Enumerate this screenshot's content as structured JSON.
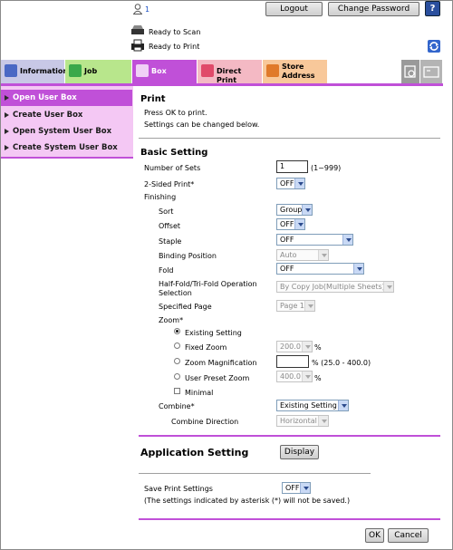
{
  "header": {
    "user_count": "1",
    "logout_label": "Logout",
    "change_password_label": "Change Password",
    "help_label": "?",
    "status_scan": "Ready to Scan",
    "status_print": "Ready to Print"
  },
  "tabs": [
    {
      "label": "Information",
      "color": "#c8c8e6",
      "icon": "information-icon"
    },
    {
      "label": "Job",
      "color": "#b8e68c",
      "icon": "job-icon"
    },
    {
      "label": "Box",
      "color": "#c050d8",
      "icon": "box-icon"
    },
    {
      "label": "Direct Print",
      "color": "#f4b9c4",
      "icon": "direct-print-icon"
    },
    {
      "label": "Store Address",
      "color": "#f8c89a",
      "icon": "store-address-icon"
    }
  ],
  "sidebar": {
    "items": [
      {
        "label": "Open User Box"
      },
      {
        "label": "Create User Box"
      },
      {
        "label": "Open System User Box"
      },
      {
        "label": "Create System User Box"
      }
    ]
  },
  "print": {
    "title": "Print",
    "line1": "Press OK to print.",
    "line2": "Settings can be changed below."
  },
  "basic": {
    "title": "Basic Setting",
    "sets_label": "Number of Sets",
    "sets_value": "1",
    "sets_range": "(1~999)",
    "sided_label": "2-Sided Print*",
    "sided_value": "OFF",
    "finishing_label": "Finishing",
    "sort_label": "Sort",
    "sort_value": "Group",
    "offset_label": "Offset",
    "offset_value": "OFF",
    "staple_label": "Staple",
    "staple_value": "OFF",
    "binding_label": "Binding Position",
    "binding_value": "Auto",
    "fold_label": "Fold",
    "fold_value": "OFF",
    "halffold_label1": "Half-Fold/Tri-Fold Operation",
    "halffold_label2": "Selection",
    "halffold_value": "By Copy Job(Multiple Sheets)",
    "specified_label": "Specified Page",
    "specified_value": "Page 1",
    "zoom_label": "Zoom*",
    "zoom_existing": "Existing Setting",
    "zoom_fixed": "Fixed Zoom",
    "zoom_fixed_value": "200.0",
    "zoom_mag": "Zoom Magnification",
    "zoom_mag_value": "",
    "zoom_mag_range": "% (25.0 - 400.0)",
    "zoom_preset": "User Preset Zoom",
    "zoom_preset_value": "400.0",
    "zoom_minimal": "Minimal",
    "percent": "%",
    "combine_label": "Combine*",
    "combine_value": "Existing Setting",
    "combine_dir_label": "Combine Direction",
    "combine_dir_value": "Horizontal"
  },
  "application": {
    "title": "Application Setting",
    "display_label": "Display"
  },
  "save": {
    "label": "Save Print Settings",
    "value": "OFF",
    "note": "(The settings indicated by asterisk (*) will not be saved.)"
  },
  "footer": {
    "ok_label": "OK",
    "cancel_label": "Cancel"
  },
  "colors": {
    "sidebar_bg": "#f4c8f4",
    "sidebar_active": "#c050d8",
    "section_rule": "#c050d8",
    "refresh_blue": "#3366cc"
  }
}
